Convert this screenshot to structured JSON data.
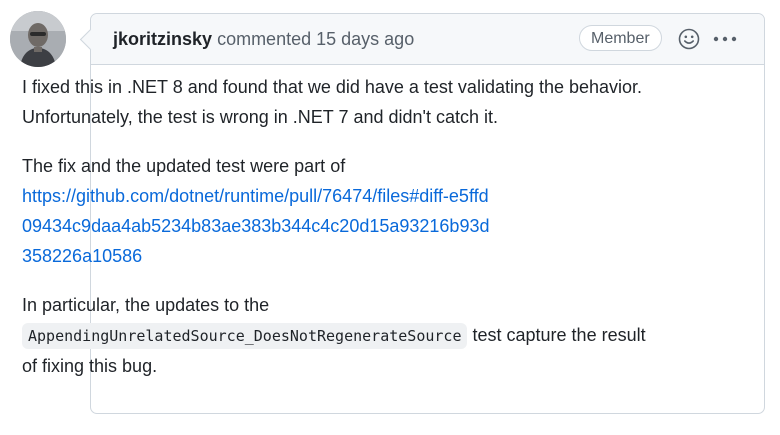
{
  "comment": {
    "author": "jkoritzinsky",
    "action": "commented",
    "time": "15 days ago",
    "badge": "Member",
    "body": {
      "p1": "I fixed this in .NET 8 and found that we did have a test validating the behavior. Unfortunately, the test is wrong in .NET 7 and didn't catch it.",
      "p2_text": "The fix and the updated test were part of",
      "p2_link": "https://github.com/dotnet/runtime/pull/76474/files#diff-e5ffd09434c9daa4ab5234b83ae383b344c4c20d15a93216b93d358226a10586",
      "p3_before": "In particular, the updates to the",
      "p3_code": "AppendingUnrelatedSource_DoesNotRegenerateSource",
      "p3_after": "test capture the result of fixing this bug."
    }
  },
  "icons": {
    "avatar": "user-avatar",
    "reaction": "smiley-icon",
    "more": "kebab-horizontal-icon"
  }
}
